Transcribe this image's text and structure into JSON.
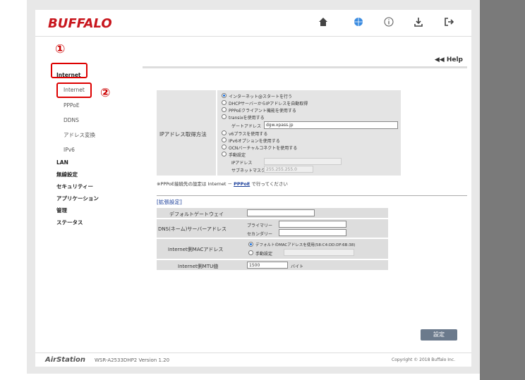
{
  "header": {
    "logo": "BUFFALO"
  },
  "markers": {
    "one": "①",
    "two": "②"
  },
  "help": "◀◀ Help",
  "sidebar": {
    "internet_group": "Internet",
    "items": [
      "Internet",
      "PPPoE",
      "DDNS",
      "アドレス変換",
      "IPv6"
    ],
    "groups": [
      "LAN",
      "無線設定",
      "セキュリティー",
      "アプリケーション",
      "管理",
      "ステータス"
    ]
  },
  "ip_section": {
    "label": "IPアドレス取得方法",
    "options": [
      "インターネット@スタートを行う",
      "DHCPサーバーからIPアドレスを自動取得",
      "PPPoEクライアント機能を使用する",
      "transixを使用する",
      "v6プラスを使用する",
      "IPv6オプションを使用する",
      "OCNバーチャルコネクトを使用する",
      "手動設定"
    ],
    "gateway_label": "ゲートアドレス",
    "gateway_value": "dgw.xpass.jp",
    "ip_label": "IPアドレス",
    "subnet_label": "サブネットマスク",
    "subnet_value": "255.255.255.0",
    "selected_index": 0
  },
  "note": {
    "prefix": "※PPPoE接続先の設定は Internet － ",
    "link": "PPPoE",
    "suffix": " で行ってください"
  },
  "ext": {
    "title": "[拡張設定]",
    "default_gw": "デフォルトゲートウェイ",
    "dns": "DNS(ネーム)サーバーアドレス",
    "primary": "プライマリー",
    "secondary": "セカンダリー",
    "mac": "Internet側MACアドレス",
    "mac_opt1": "デフォルトのMACアドレスを使用(58:C4:DD:DF:6B:38)",
    "mac_opt2": "手動設定",
    "mtu": "Internet側MTU値",
    "mtu_value": "1500",
    "mtu_unit": "バイト"
  },
  "save_button": "設定",
  "footer": {
    "brand": "AirStation",
    "model": "WSR-A2533DHP2  Version 1.20",
    "copyright": "Copyright © 2018 Buffalo Inc."
  },
  "colors": {
    "brand": "#c8161d",
    "marker": "#cc0000",
    "accent": "#1a6ed8"
  }
}
